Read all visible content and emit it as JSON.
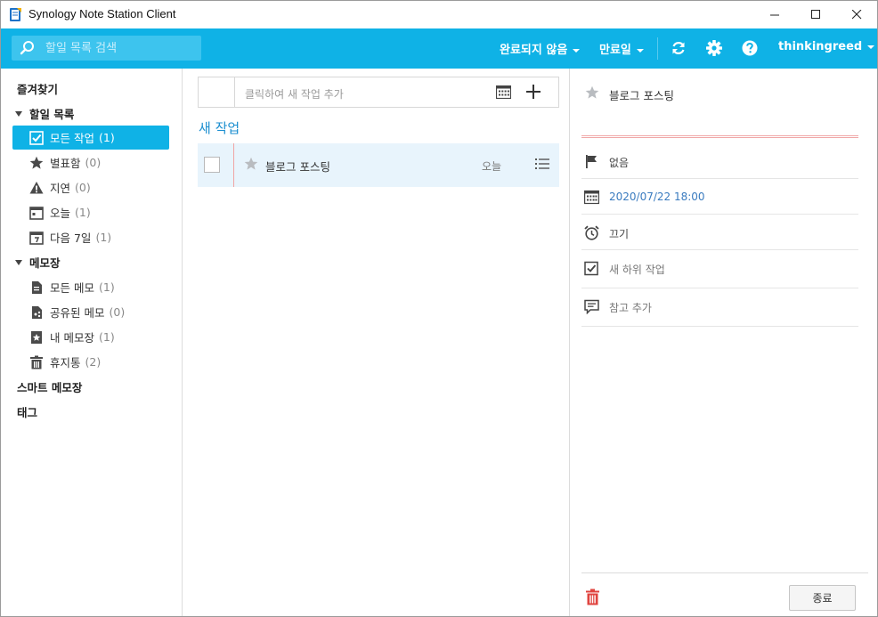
{
  "window": {
    "title": "Synology Note Station Client"
  },
  "toolbar": {
    "search_placeholder": "할일 목록 검색",
    "filter_label": "완료되지 않음",
    "sort_label": "만료일",
    "user_label": "thinkingreed"
  },
  "sidebar": {
    "favorites": "즐겨찾기",
    "todo_section": "할일 목록",
    "todo_items": [
      {
        "label": "모든 작업",
        "count": "(1)"
      },
      {
        "label": "별표함",
        "count": "(0)"
      },
      {
        "label": "지연",
        "count": "(0)"
      },
      {
        "label": "오늘",
        "count": "(1)"
      },
      {
        "label": "다음 7일",
        "count": "(1)"
      }
    ],
    "notebook_section": "메모장",
    "notebook_items": [
      {
        "label": "모든 메모",
        "count": "(1)"
      },
      {
        "label": "공유된 메모",
        "count": "(0)"
      },
      {
        "label": "내 메모장",
        "count": "(1)"
      },
      {
        "label": "휴지통",
        "count": "(2)"
      }
    ],
    "smart_notebook": "스마트 메모장",
    "tags": "태그"
  },
  "tasks": {
    "add_placeholder": "클릭하여 새 작업 추가",
    "group_title": "새 작업",
    "rows": [
      {
        "title": "블로그 포스팅",
        "due": "오늘"
      }
    ]
  },
  "detail": {
    "title": "블로그 포스팅",
    "priority": "없음",
    "due_date": "2020/07/22 18:00",
    "reminder": "끄기",
    "subtask": "새 하위 작업",
    "note": "참고 추가",
    "close_label": "종료"
  },
  "colors": {
    "accent": "#0fb2e6",
    "active_row": "#e8f4fc",
    "link_blue": "#1c8fd0",
    "delete_red": "#e0443f"
  }
}
